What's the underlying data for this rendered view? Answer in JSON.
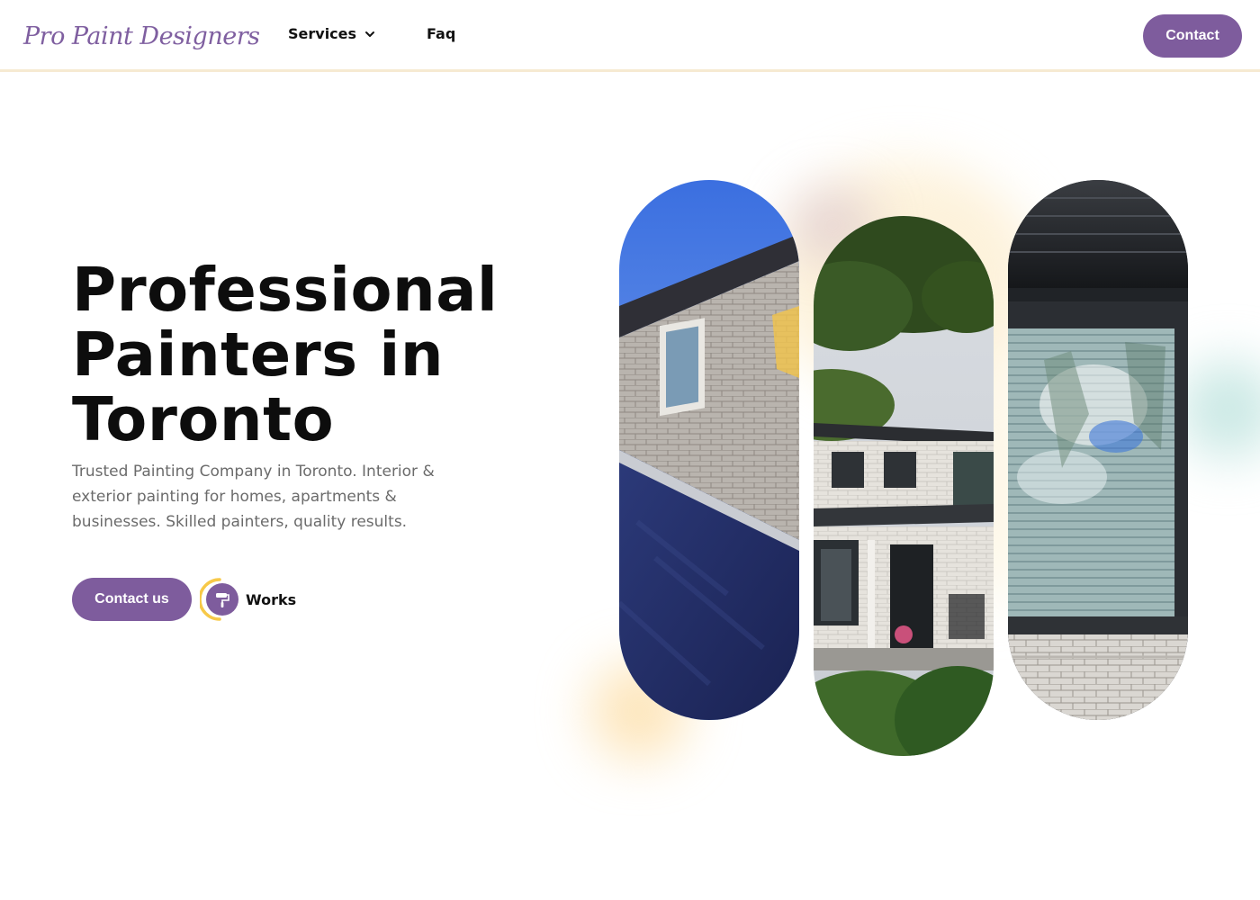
{
  "header": {
    "logo_text": "Pro Paint Designers",
    "nav": {
      "services_label": "Services",
      "faq_label": "Faq"
    },
    "contact_label": "Contact"
  },
  "hero": {
    "title_lines": [
      "Professional",
      "Painters in",
      "Toronto"
    ],
    "description": "Trusted Painting Company in Toronto. Interior & exterior painting for homes, apartments & businesses. Skilled painters, quality results.",
    "cta_label": "Contact us",
    "works_label": "Works"
  },
  "icons": [
    "logo-mark-icon",
    "chevron-down-icon",
    "paint-roller-icon"
  ],
  "colors": {
    "brand_purple": "#7e5c9d",
    "accent_yellow": "#f7c948",
    "header_border": "#f6ead2",
    "body_text": "#6b6b6b"
  }
}
